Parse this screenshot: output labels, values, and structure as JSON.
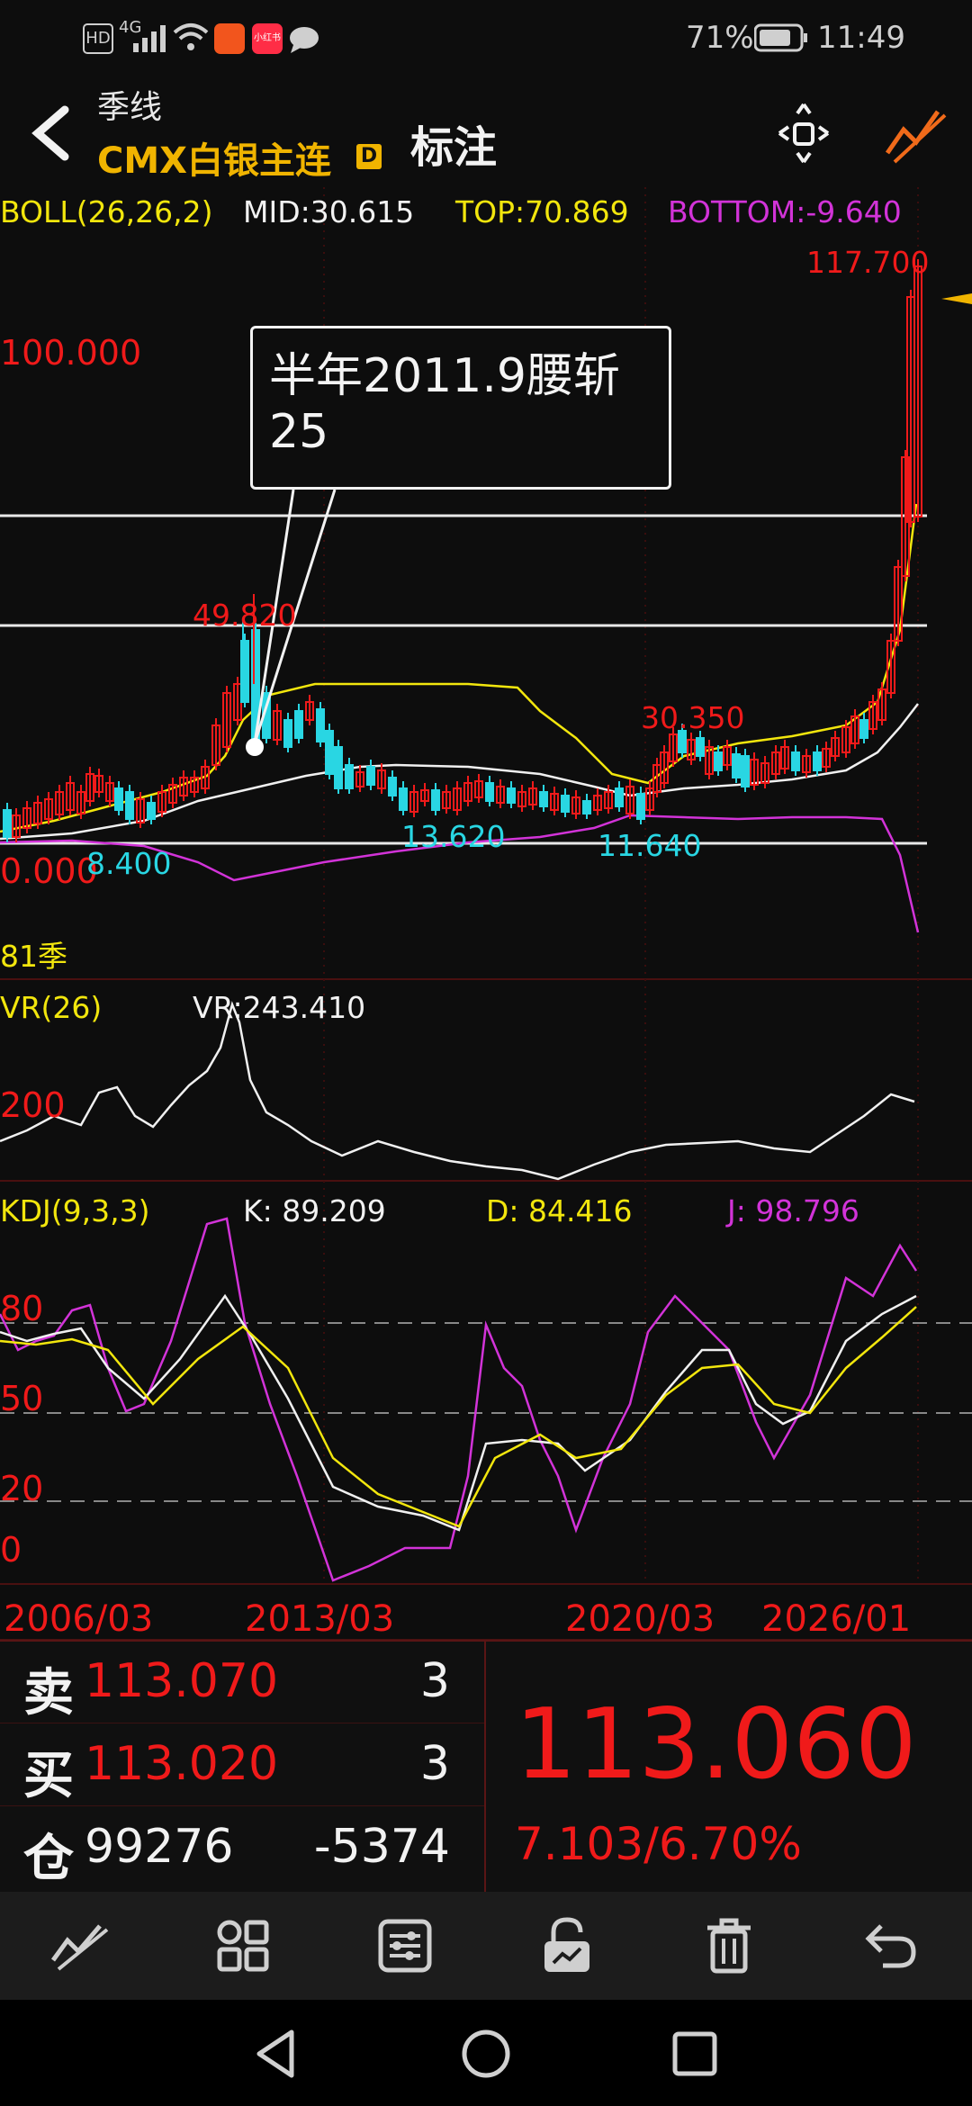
{
  "status_bar": {
    "net": "4G",
    "app_badge": "小红书",
    "battery": "71%",
    "time": "11:49"
  },
  "header": {
    "period": "季线",
    "symbol": "CMX白银主连",
    "symbol_badge": "D",
    "title": "标注"
  },
  "boll": {
    "label": "BOLL(26,26,2)",
    "mid": "MID:30.615",
    "top": "TOP:70.869",
    "bottom": "BOTTOM:-9.640"
  },
  "price_labels": {
    "high": "117.700",
    "y100": "100.000",
    "y0": "0.000",
    "p49": "49.820",
    "p8": "8.400",
    "p13": "13.620",
    "p11": "11.640",
    "p30": "30.350",
    "count": "81季"
  },
  "annotation": {
    "text": "半年2011.9腰斩25"
  },
  "vr": {
    "label": "VR(26)",
    "value": "VR:243.410",
    "y200": "200"
  },
  "kdj": {
    "label": "KDJ(9,3,3)",
    "k": "K: 89.209",
    "d": "D: 84.416",
    "j": "J: 98.796",
    "y80": "80",
    "y50": "50",
    "y20": "20",
    "y0": "0"
  },
  "x_axis": {
    "labels": [
      "2006/03",
      "2013/03",
      "2020/03",
      "2026/01"
    ]
  },
  "orderbook": {
    "rows": [
      {
        "side": "卖",
        "price": "113.070",
        "qty": "3"
      },
      {
        "side": "买",
        "price": "113.020",
        "qty": "3"
      },
      {
        "side": "仓",
        "price": "99276",
        "qty": "-5374"
      }
    ],
    "last_price": "113.060",
    "change": "7.103/6.70%"
  },
  "colors": {
    "up": "#f01a1a",
    "down": "#29d6e3",
    "ma_yellow": "#f2e60d",
    "magenta": "#d233d8",
    "bg": "#0d0d0d"
  },
  "toolbar": {
    "icons": [
      "draw-line-icon",
      "grid-icon",
      "settings-sliders-icon",
      "unlock-icon",
      "trash-icon",
      "undo-icon"
    ]
  }
}
